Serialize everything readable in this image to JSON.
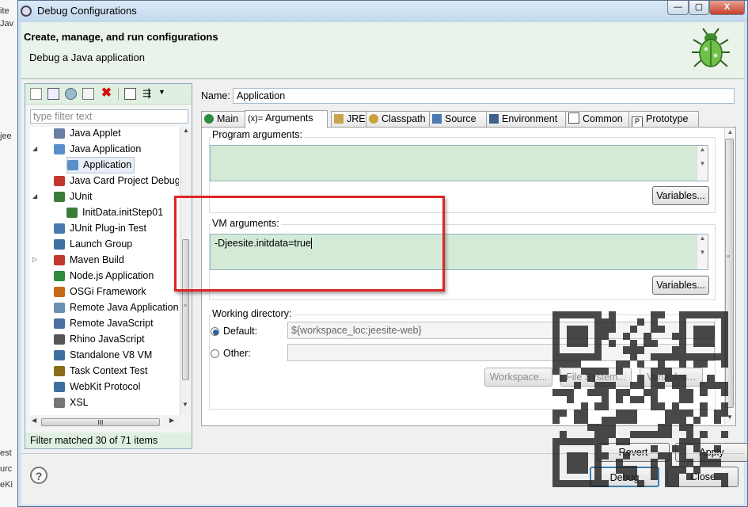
{
  "background": {
    "snippets": [
      "ite",
      "Jav",
      "jee",
      "est",
      "urc",
      "eKi"
    ]
  },
  "window": {
    "title": "Debug Configurations",
    "buttons": {
      "minimize": "—",
      "maximize": "▢",
      "close": "X"
    }
  },
  "banner": {
    "title": "Create, manage, and run configurations",
    "subtitle": "Debug a Java application",
    "icon": "bug-icon"
  },
  "left": {
    "filter_placeholder": "type filter text",
    "items": [
      {
        "label": "Java Applet",
        "icon": "applet-icon",
        "color": "#6b7fa3"
      },
      {
        "label": "Java Application",
        "icon": "java-app-icon",
        "color": "#5b8fc9"
      },
      {
        "label": "Application",
        "icon": "java-app-icon",
        "color": "#5b8fc9"
      },
      {
        "label": "Java Card Project Debug",
        "icon": "javacard-icon",
        "color": "#c0392b"
      },
      {
        "label": "JUnit",
        "icon": "junit-icon",
        "color": "#3a7d3a"
      },
      {
        "label": "InitData.initStep01",
        "icon": "junit-icon",
        "color": "#3a7d3a"
      },
      {
        "label": "JUnit Plug-in Test",
        "icon": "junit-plugin-icon",
        "color": "#4a7bb0"
      },
      {
        "label": "Launch Group",
        "icon": "launch-group-icon",
        "color": "#3d6fa0"
      },
      {
        "label": "Maven Build",
        "icon": "maven-icon",
        "color": "#c0392b"
      },
      {
        "label": "Node.js Application",
        "icon": "nodejs-icon",
        "color": "#2e8b3d"
      },
      {
        "label": "OSGi Framework",
        "icon": "osgi-icon",
        "color": "#c46a1a"
      },
      {
        "label": "Remote Java Application",
        "icon": "remote-java-icon",
        "color": "#6a8fb5"
      },
      {
        "label": "Remote JavaScript",
        "icon": "remote-js-icon",
        "color": "#4a6fa0"
      },
      {
        "label": "Rhino JavaScript",
        "icon": "rhino-icon",
        "color": "#555555"
      },
      {
        "label": "Standalone V8 VM",
        "icon": "v8-icon",
        "color": "#3d6fa0"
      },
      {
        "label": "Task Context Test",
        "icon": "task-context-icon",
        "color": "#8a6d1a"
      },
      {
        "label": "WebKit Protocol",
        "icon": "webkit-icon",
        "color": "#3d6fa0"
      },
      {
        "label": "XSL",
        "icon": "xsl-icon",
        "color": "#777777"
      }
    ],
    "status": "Filter matched 30 of 71 items"
  },
  "right": {
    "name_label": "Name:",
    "name_value": "Application",
    "tabs": [
      {
        "label": "Main",
        "icon": "main-tab-icon"
      },
      {
        "label": "Arguments",
        "icon": "arguments-tab-icon"
      },
      {
        "label": "JRE",
        "icon": "jre-tab-icon"
      },
      {
        "label": "Classpath",
        "icon": "classpath-tab-icon"
      },
      {
        "label": "Source",
        "icon": "source-tab-icon"
      },
      {
        "label": "Environment",
        "icon": "environment-tab-icon"
      },
      {
        "label": "Common",
        "icon": "common-tab-icon"
      },
      {
        "label": "Prototype",
        "icon": "prototype-tab-icon"
      }
    ],
    "arguments_tab_prefix": "(x)=",
    "program_args_label": "Program arguments:",
    "program_args_value": "",
    "variables_label": "Variables...",
    "vm_args_label": "VM arguments:",
    "vm_args_value": "-Djeesite.initdata=true",
    "working_dir_label": "Working directory:",
    "default_label": "Default:",
    "default_value": "${workspace_loc:jeesite-web}",
    "other_label": "Other:",
    "workspace_btn": "Workspace...",
    "filesystem_btn": "File System...",
    "wd_variables_btn": "Variables..."
  },
  "footer": {
    "revert": "Revert",
    "apply": "Apply",
    "debug": "Debug",
    "close": "Close",
    "help_glyph": "?"
  }
}
